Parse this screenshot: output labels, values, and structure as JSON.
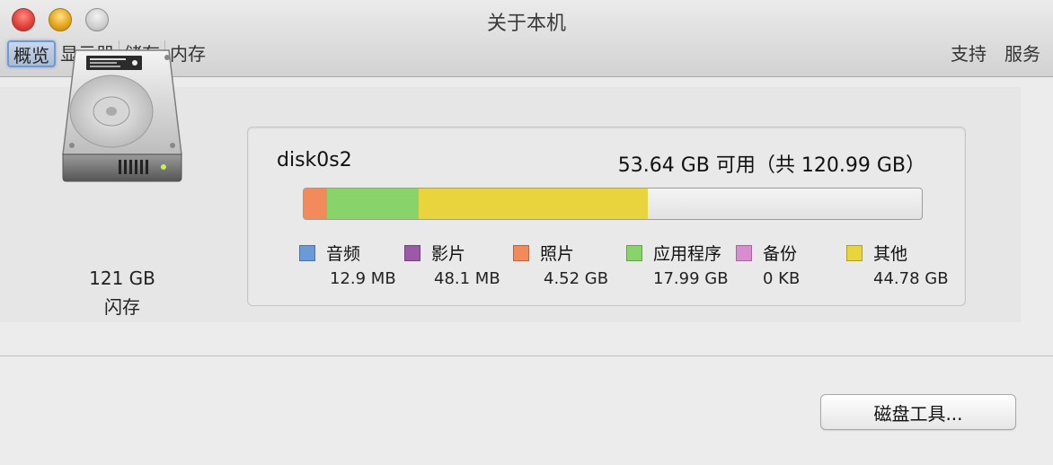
{
  "window": {
    "title": "关于本机"
  },
  "toolbar": {
    "tabs": [
      {
        "label": "概览",
        "active": true
      },
      {
        "label": "显示器",
        "active": false
      },
      {
        "label": "储存",
        "active": false
      },
      {
        "label": "内存",
        "active": false
      }
    ],
    "right_links": [
      {
        "label": "支持"
      },
      {
        "label": "服务"
      }
    ]
  },
  "disk": {
    "size": "121 GB",
    "type": "闪存",
    "icon": "hard-drive-icon"
  },
  "storage": {
    "volume_name": "disk0s2",
    "free_text": "53.64 GB 可用（共 120.99 GB）",
    "categories": [
      {
        "label": "音频",
        "value": "12.9 MB",
        "color": "#6a9bd6",
        "fraction": 0.0001
      },
      {
        "label": "影片",
        "value": "48.1 MB",
        "color": "#9b59a8",
        "fraction": 0.0004
      },
      {
        "label": "照片",
        "value": "4.52 GB",
        "color": "#f28a5b",
        "fraction": 0.0374
      },
      {
        "label": "应用程序",
        "value": "17.99 GB",
        "color": "#88d46a",
        "fraction": 0.1487
      },
      {
        "label": "备份",
        "value": "0 KB",
        "color": "#d98ccf",
        "fraction": 0.0
      },
      {
        "label": "其他",
        "value": "44.78 GB",
        "color": "#e8d43c",
        "fraction": 0.3701
      }
    ]
  },
  "buttons": {
    "disk_utility": "磁盘工具..."
  }
}
